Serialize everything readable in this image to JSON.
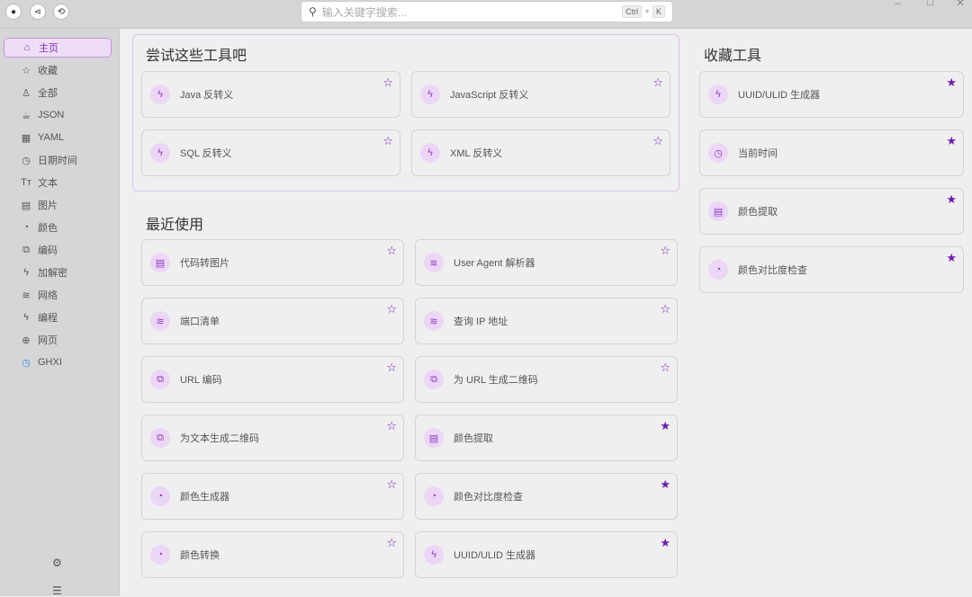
{
  "topbar": {
    "search_placeholder": "输入关键字搜索...",
    "shortcut_ctrl": "Ctrl",
    "shortcut_plus": "+",
    "shortcut_k": "K"
  },
  "sidebar": {
    "items": [
      {
        "label": "主页",
        "icon": "home-icon",
        "glyph": "⌂",
        "active": true
      },
      {
        "label": "收藏",
        "icon": "star-icon",
        "glyph": "☆"
      },
      {
        "label": "全部",
        "icon": "rocket-icon",
        "glyph": "♙"
      },
      {
        "label": "JSON",
        "icon": "cup-icon",
        "glyph": "☕"
      },
      {
        "label": "YAML",
        "icon": "grid-icon",
        "glyph": "▦"
      },
      {
        "label": "日期时间",
        "icon": "clock-icon",
        "glyph": "◷"
      },
      {
        "label": "文本",
        "icon": "text-icon",
        "glyph": "Tт"
      },
      {
        "label": "图片",
        "icon": "file-image-icon",
        "glyph": "▤"
      },
      {
        "label": "颜色",
        "icon": "pie-icon",
        "glyph": "◔"
      },
      {
        "label": "编码",
        "icon": "copy-icon",
        "glyph": "⧉"
      },
      {
        "label": "加解密",
        "icon": "bolt-icon",
        "glyph": "ϟ"
      },
      {
        "label": "网络",
        "icon": "wifi-icon",
        "glyph": "≋"
      },
      {
        "label": "编程",
        "icon": "bolt-icon",
        "glyph": "ϟ"
      },
      {
        "label": "网页",
        "icon": "globe-icon",
        "glyph": "⊕"
      },
      {
        "label": "GHXI",
        "icon": "ghxi-clock-icon",
        "glyph": "◷"
      }
    ]
  },
  "try": {
    "title": "尝试这些工具吧",
    "items": [
      {
        "label": "Java 反转义",
        "glyph": "ϟ",
        "fav": false
      },
      {
        "label": "JavaScript 反转义",
        "glyph": "ϟ",
        "fav": false
      },
      {
        "label": "SQL 反转义",
        "glyph": "ϟ",
        "fav": false
      },
      {
        "label": "XML 反转义",
        "glyph": "ϟ",
        "fav": false
      }
    ]
  },
  "recent": {
    "title": "最近使用",
    "items": [
      {
        "label": "代码转图片",
        "glyph": "▤",
        "fav": false
      },
      {
        "label": "User Agent 解析器",
        "glyph": "≋",
        "fav": false
      },
      {
        "label": "端口清单",
        "glyph": "≋",
        "fav": false
      },
      {
        "label": "查询 IP 地址",
        "glyph": "≋",
        "fav": false
      },
      {
        "label": "URL 编码",
        "glyph": "⧉",
        "fav": false
      },
      {
        "label": "为 URL 生成二维码",
        "glyph": "⧉",
        "fav": false
      },
      {
        "label": "为文本生成二维码",
        "glyph": "⧉",
        "fav": false
      },
      {
        "label": "颜色提取",
        "glyph": "▤",
        "fav": true
      },
      {
        "label": "颜色生成器",
        "glyph": "◔",
        "fav": false
      },
      {
        "label": "颜色对比度检查",
        "glyph": "◔",
        "fav": true
      },
      {
        "label": "颜色转换",
        "glyph": "◔",
        "fav": false
      },
      {
        "label": "UUID/ULID 生成器",
        "glyph": "ϟ",
        "fav": true
      }
    ]
  },
  "favorites": {
    "title": "收藏工具",
    "items": [
      {
        "label": "UUID/ULID 生成器",
        "glyph": "ϟ",
        "fav": true
      },
      {
        "label": "当前时间",
        "glyph": "◷",
        "fav": true
      },
      {
        "label": "颜色提取",
        "glyph": "▤",
        "fav": true
      },
      {
        "label": "颜色对比度检查",
        "glyph": "◔",
        "fav": true
      }
    ]
  }
}
